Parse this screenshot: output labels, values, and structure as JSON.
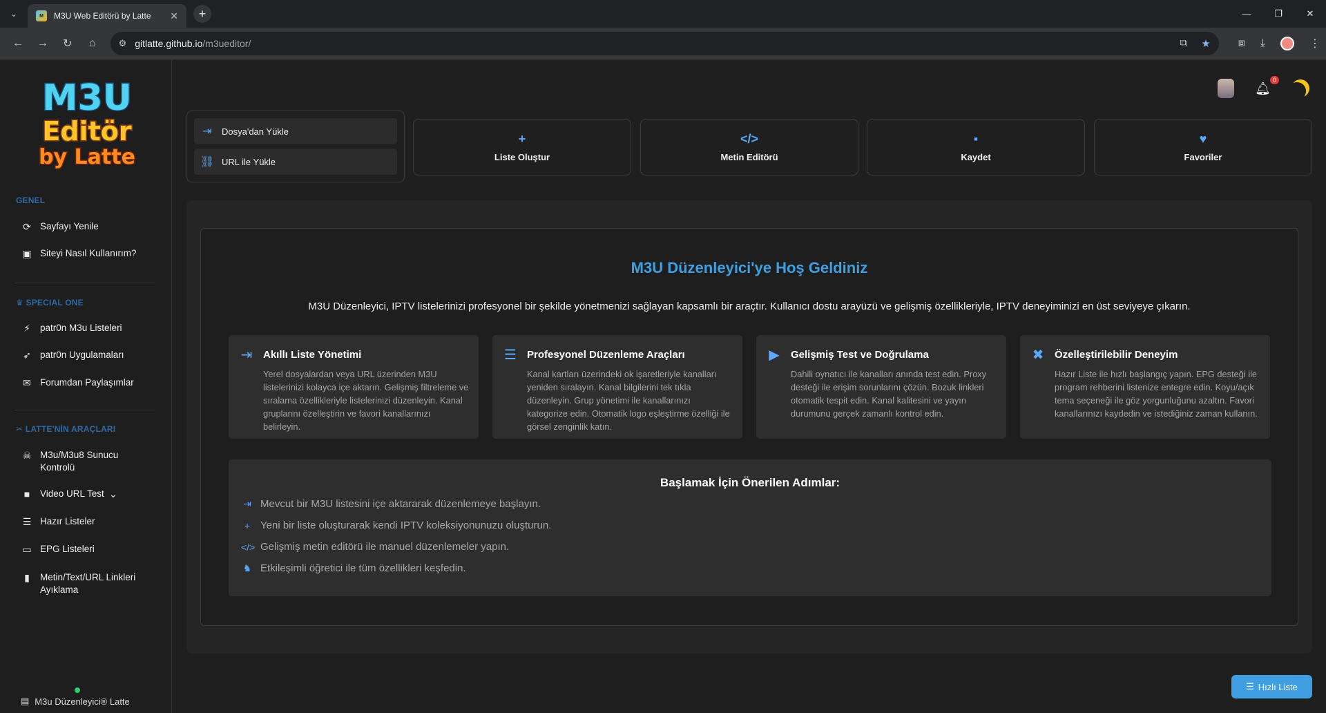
{
  "browser": {
    "tab_title": "M3U Web Editörü by Latte",
    "url_host": "gitlatte.github.io",
    "url_path": "/m3ueditor/"
  },
  "sidebar": {
    "logo_lines": [
      "M3U",
      "Editör",
      "by Latte"
    ],
    "sections": [
      {
        "heading": "GENEL",
        "color": "#3f7fbf",
        "items": [
          {
            "label": "Sayfayı Yenile",
            "icon": "refresh-icon"
          },
          {
            "label": "Siteyi Nasıl Kullanırım?",
            "icon": "chalkboard-icon"
          }
        ]
      },
      {
        "heading": "SPECIAL ONE",
        "color": "#3f7fbf",
        "items": [
          {
            "label": "patr0n M3u Listeleri",
            "icon": "bolt-icon"
          },
          {
            "label": "patr0n Uygulamaları",
            "icon": "rocket-icon"
          },
          {
            "label": "Forumdan Paylaşımlar",
            "icon": "comments-icon"
          }
        ]
      },
      {
        "heading": "LATTE'NİN ARAÇLARI",
        "color": "#3f7fbf",
        "items": [
          {
            "label": "M3u/M3u8 Sunucu Kontrolü",
            "icon": "skull-icon"
          },
          {
            "label": "Video URL Test",
            "icon": "video-icon"
          },
          {
            "label": "Hazır Listeler",
            "icon": "list-icon"
          },
          {
            "label": "EPG Listeleri",
            "icon": "monitor-icon"
          },
          {
            "label": "Metin/Text/URL Linkleri Ayıklama",
            "icon": "file-icon"
          }
        ]
      }
    ],
    "footer": "M3u Düzenleyici® Latte"
  },
  "header": {
    "notification_count": "0"
  },
  "load": {
    "file_label": "Dosya'dan Yükle",
    "url_label": "URL ile Yükle"
  },
  "actions": [
    {
      "label": "Liste Oluştur",
      "icon": "plus-icon"
    },
    {
      "label": "Metin Editörü",
      "icon": "code-icon"
    },
    {
      "label": "Kaydet",
      "icon": "save-icon"
    },
    {
      "label": "Favoriler",
      "icon": "heart-icon"
    }
  ],
  "welcome": {
    "title": "M3U Düzenleyici'ye Hoş Geldiniz",
    "description": "M3U Düzenleyici, IPTV listelerinizi profesyonel bir şekilde yönetmenizi sağlayan kapsamlı bir araçtır. Kullanıcı dostu arayüzü ve gelişmiş özellikleriyle, IPTV deneyiminizi en üst seviyeye çıkarın.",
    "cards": [
      {
        "title": "Akıllı Liste Yönetimi",
        "icon": "file-import-icon",
        "text": "Yerel dosyalardan veya URL üzerinden M3U listelerinizi kolayca içe aktarın. Gelişmiş filtreleme ve sıralama özellikleriyle listelerinizi düzenleyin. Kanal gruplarını özelleştirin ve favori kanallarınızı belirleyin."
      },
      {
        "title": "Profesyonel Düzenleme Araçları",
        "icon": "list-icon",
        "text": "Kanal kartları üzerindeki ok işaretleriyle kanalları yeniden sıralayın. Kanal bilgilerini tek tıkla düzenleyin. Grup yönetimi ile kanallarınızı kategorize edin. Otomatik logo eşleştirme özelliği ile görsel zenginlik katın."
      },
      {
        "title": "Gelişmiş Test ve Doğrulama",
        "icon": "play-circle-icon",
        "text": "Dahili oynatıcı ile kanalları anında test edin. Proxy desteği ile erişim sorunlarını çözün. Bozuk linkleri otomatik tespit edin. Kanal kalitesini ve yayın durumunu gerçek zamanlı kontrol edin."
      },
      {
        "title": "Özelleştirilebilir Deneyim",
        "icon": "tools-icon",
        "text": "Hazır Liste ile hızlı başlangıç yapın. EPG desteği ile program rehberini listenize entegre edin. Koyu/açık tema seçeneği ile göz yorgunluğunu azaltın. Favori kanallarınızı kaydedin ve istediğiniz zaman kullanın."
      }
    ],
    "steps_title": "Başlamak İçin Önerilen Adımlar:",
    "steps": [
      {
        "text": "Mevcut bir M3U listesini içe aktararak düzenlemeye başlayın.",
        "icon": "file-import-icon"
      },
      {
        "text": "Yeni bir liste oluşturarak kendi IPTV koleksiyonunuzu oluşturun.",
        "icon": "plus-icon"
      },
      {
        "text": "Gelişmiş metin editörü ile manuel düzenlemeler yapın.",
        "icon": "code-icon"
      },
      {
        "text": "Etkileşimli öğretici ile tüm özellikleri keşfedin.",
        "icon": "graduation-cap-icon"
      }
    ]
  },
  "quick_list": "Hızlı Liste",
  "colors": {
    "accent": "#3f9fe0",
    "icon_blue": "#5aa9ff",
    "background": "#1f1f1f"
  }
}
